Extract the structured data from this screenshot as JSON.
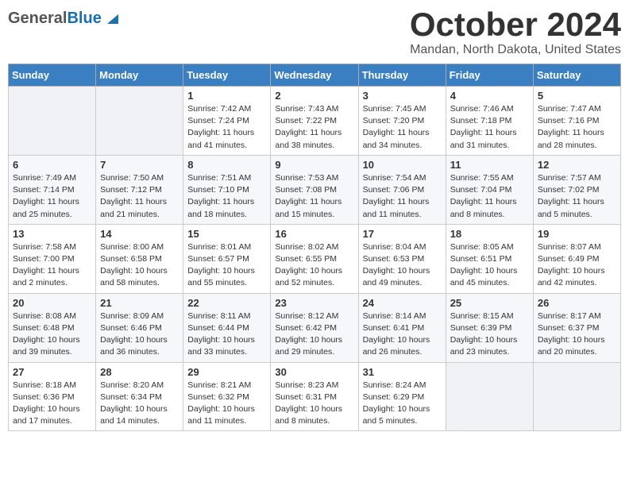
{
  "header": {
    "logo_general": "General",
    "logo_blue": "Blue",
    "month": "October 2024",
    "location": "Mandan, North Dakota, United States"
  },
  "weekdays": [
    "Sunday",
    "Monday",
    "Tuesday",
    "Wednesday",
    "Thursday",
    "Friday",
    "Saturday"
  ],
  "weeks": [
    [
      {
        "day": "",
        "text": ""
      },
      {
        "day": "",
        "text": ""
      },
      {
        "day": "1",
        "text": "Sunrise: 7:42 AM\nSunset: 7:24 PM\nDaylight: 11 hours and 41 minutes."
      },
      {
        "day": "2",
        "text": "Sunrise: 7:43 AM\nSunset: 7:22 PM\nDaylight: 11 hours and 38 minutes."
      },
      {
        "day": "3",
        "text": "Sunrise: 7:45 AM\nSunset: 7:20 PM\nDaylight: 11 hours and 34 minutes."
      },
      {
        "day": "4",
        "text": "Sunrise: 7:46 AM\nSunset: 7:18 PM\nDaylight: 11 hours and 31 minutes."
      },
      {
        "day": "5",
        "text": "Sunrise: 7:47 AM\nSunset: 7:16 PM\nDaylight: 11 hours and 28 minutes."
      }
    ],
    [
      {
        "day": "6",
        "text": "Sunrise: 7:49 AM\nSunset: 7:14 PM\nDaylight: 11 hours and 25 minutes."
      },
      {
        "day": "7",
        "text": "Sunrise: 7:50 AM\nSunset: 7:12 PM\nDaylight: 11 hours and 21 minutes."
      },
      {
        "day": "8",
        "text": "Sunrise: 7:51 AM\nSunset: 7:10 PM\nDaylight: 11 hours and 18 minutes."
      },
      {
        "day": "9",
        "text": "Sunrise: 7:53 AM\nSunset: 7:08 PM\nDaylight: 11 hours and 15 minutes."
      },
      {
        "day": "10",
        "text": "Sunrise: 7:54 AM\nSunset: 7:06 PM\nDaylight: 11 hours and 11 minutes."
      },
      {
        "day": "11",
        "text": "Sunrise: 7:55 AM\nSunset: 7:04 PM\nDaylight: 11 hours and 8 minutes."
      },
      {
        "day": "12",
        "text": "Sunrise: 7:57 AM\nSunset: 7:02 PM\nDaylight: 11 hours and 5 minutes."
      }
    ],
    [
      {
        "day": "13",
        "text": "Sunrise: 7:58 AM\nSunset: 7:00 PM\nDaylight: 11 hours and 2 minutes."
      },
      {
        "day": "14",
        "text": "Sunrise: 8:00 AM\nSunset: 6:58 PM\nDaylight: 10 hours and 58 minutes."
      },
      {
        "day": "15",
        "text": "Sunrise: 8:01 AM\nSunset: 6:57 PM\nDaylight: 10 hours and 55 minutes."
      },
      {
        "day": "16",
        "text": "Sunrise: 8:02 AM\nSunset: 6:55 PM\nDaylight: 10 hours and 52 minutes."
      },
      {
        "day": "17",
        "text": "Sunrise: 8:04 AM\nSunset: 6:53 PM\nDaylight: 10 hours and 49 minutes."
      },
      {
        "day": "18",
        "text": "Sunrise: 8:05 AM\nSunset: 6:51 PM\nDaylight: 10 hours and 45 minutes."
      },
      {
        "day": "19",
        "text": "Sunrise: 8:07 AM\nSunset: 6:49 PM\nDaylight: 10 hours and 42 minutes."
      }
    ],
    [
      {
        "day": "20",
        "text": "Sunrise: 8:08 AM\nSunset: 6:48 PM\nDaylight: 10 hours and 39 minutes."
      },
      {
        "day": "21",
        "text": "Sunrise: 8:09 AM\nSunset: 6:46 PM\nDaylight: 10 hours and 36 minutes."
      },
      {
        "day": "22",
        "text": "Sunrise: 8:11 AM\nSunset: 6:44 PM\nDaylight: 10 hours and 33 minutes."
      },
      {
        "day": "23",
        "text": "Sunrise: 8:12 AM\nSunset: 6:42 PM\nDaylight: 10 hours and 29 minutes."
      },
      {
        "day": "24",
        "text": "Sunrise: 8:14 AM\nSunset: 6:41 PM\nDaylight: 10 hours and 26 minutes."
      },
      {
        "day": "25",
        "text": "Sunrise: 8:15 AM\nSunset: 6:39 PM\nDaylight: 10 hours and 23 minutes."
      },
      {
        "day": "26",
        "text": "Sunrise: 8:17 AM\nSunset: 6:37 PM\nDaylight: 10 hours and 20 minutes."
      }
    ],
    [
      {
        "day": "27",
        "text": "Sunrise: 8:18 AM\nSunset: 6:36 PM\nDaylight: 10 hours and 17 minutes."
      },
      {
        "day": "28",
        "text": "Sunrise: 8:20 AM\nSunset: 6:34 PM\nDaylight: 10 hours and 14 minutes."
      },
      {
        "day": "29",
        "text": "Sunrise: 8:21 AM\nSunset: 6:32 PM\nDaylight: 10 hours and 11 minutes."
      },
      {
        "day": "30",
        "text": "Sunrise: 8:23 AM\nSunset: 6:31 PM\nDaylight: 10 hours and 8 minutes."
      },
      {
        "day": "31",
        "text": "Sunrise: 8:24 AM\nSunset: 6:29 PM\nDaylight: 10 hours and 5 minutes."
      },
      {
        "day": "",
        "text": ""
      },
      {
        "day": "",
        "text": ""
      }
    ]
  ]
}
